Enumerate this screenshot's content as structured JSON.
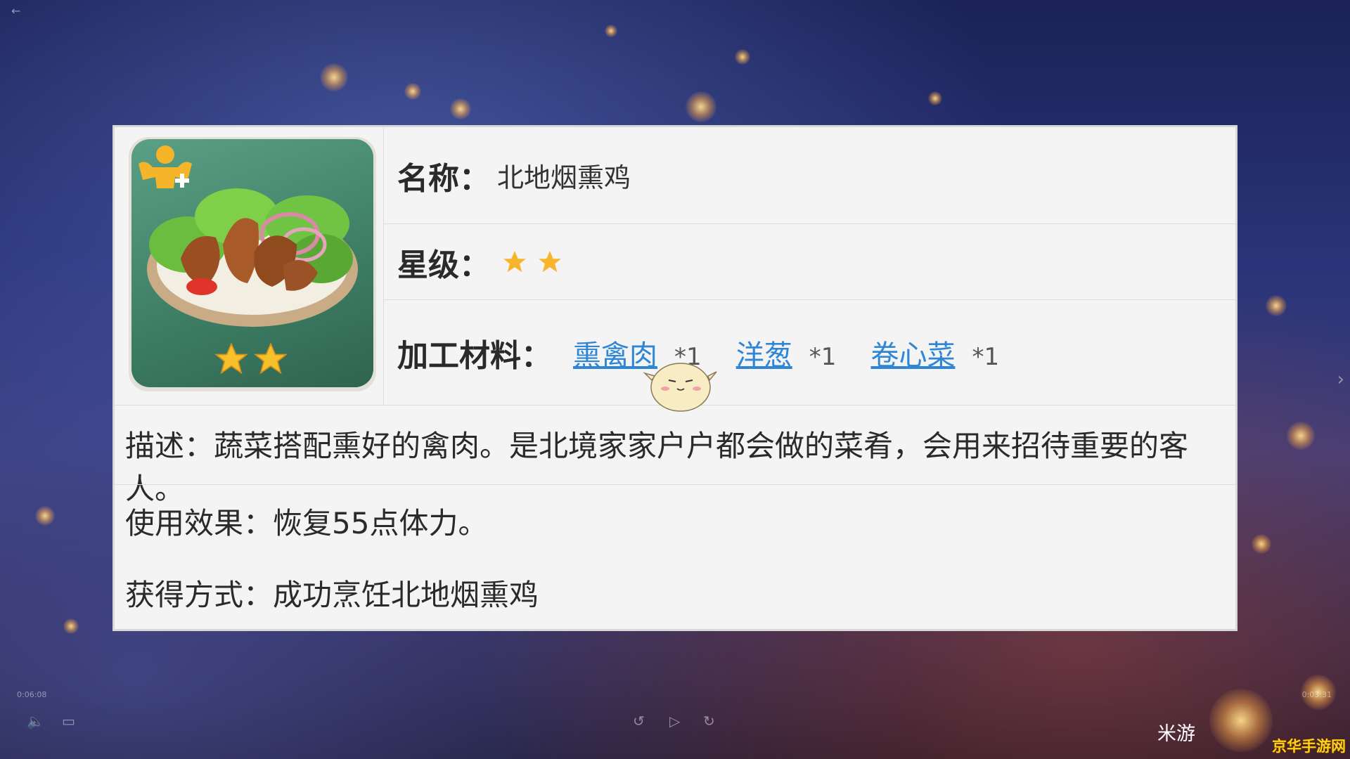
{
  "item": {
    "name_label": "名称：",
    "name_value": "北地烟熏鸡",
    "rarity_label": "星级：",
    "rarity": 2,
    "materials_label": "加工材料：",
    "materials": [
      {
        "name": "熏禽肉",
        "qty": "*1"
      },
      {
        "name": "洋葱",
        "qty": "*1"
      },
      {
        "name": "卷心菜",
        "qty": "*1"
      }
    ],
    "description": "描述：蔬菜搭配熏好的禽肉。是北境家家户户都会做的菜肴，会用来招待重要的客人。",
    "effect": "使用效果：恢复55点体力。",
    "source": "获得方式：成功烹饪北地烟熏鸡"
  },
  "player": {
    "time_elapsed": "0:06:08",
    "time_remaining": "0:03:31"
  },
  "brand": "米游",
  "watermark": "京华手游网",
  "colors": {
    "star": "#f7b52c",
    "link": "#2e86d4",
    "card_bg": "#f4f4f4"
  }
}
